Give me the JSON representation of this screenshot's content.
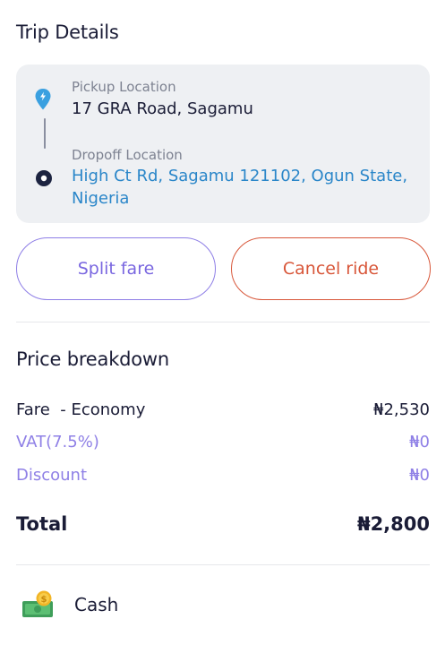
{
  "trip": {
    "title": "Trip Details",
    "pickup_label": "Pickup Location",
    "pickup_value": "17 GRA Road, Sagamu",
    "dropoff_label": "Dropoff Location",
    "dropoff_value": "High Ct Rd, Sagamu 121102, Ogun State, Nigeria"
  },
  "actions": {
    "split_fare": "Split fare",
    "cancel_ride": "Cancel ride"
  },
  "price": {
    "title": "Price breakdown",
    "rows": [
      {
        "label": "Fare  - Economy",
        "value": "₦2,530"
      },
      {
        "label": "VAT(7.5%)",
        "value": "₦0"
      },
      {
        "label": "Discount",
        "value": "₦0"
      }
    ],
    "total_label": "Total",
    "total_value": "₦2,800"
  },
  "payment": {
    "method": "Cash",
    "icon": "cash-icon"
  },
  "colors": {
    "accent_purple": "#7a67e0",
    "danger_red": "#d8573a",
    "link_blue": "#2a86c9",
    "pin_blue": "#3aa0e0",
    "card_bg": "#eef0f3"
  }
}
